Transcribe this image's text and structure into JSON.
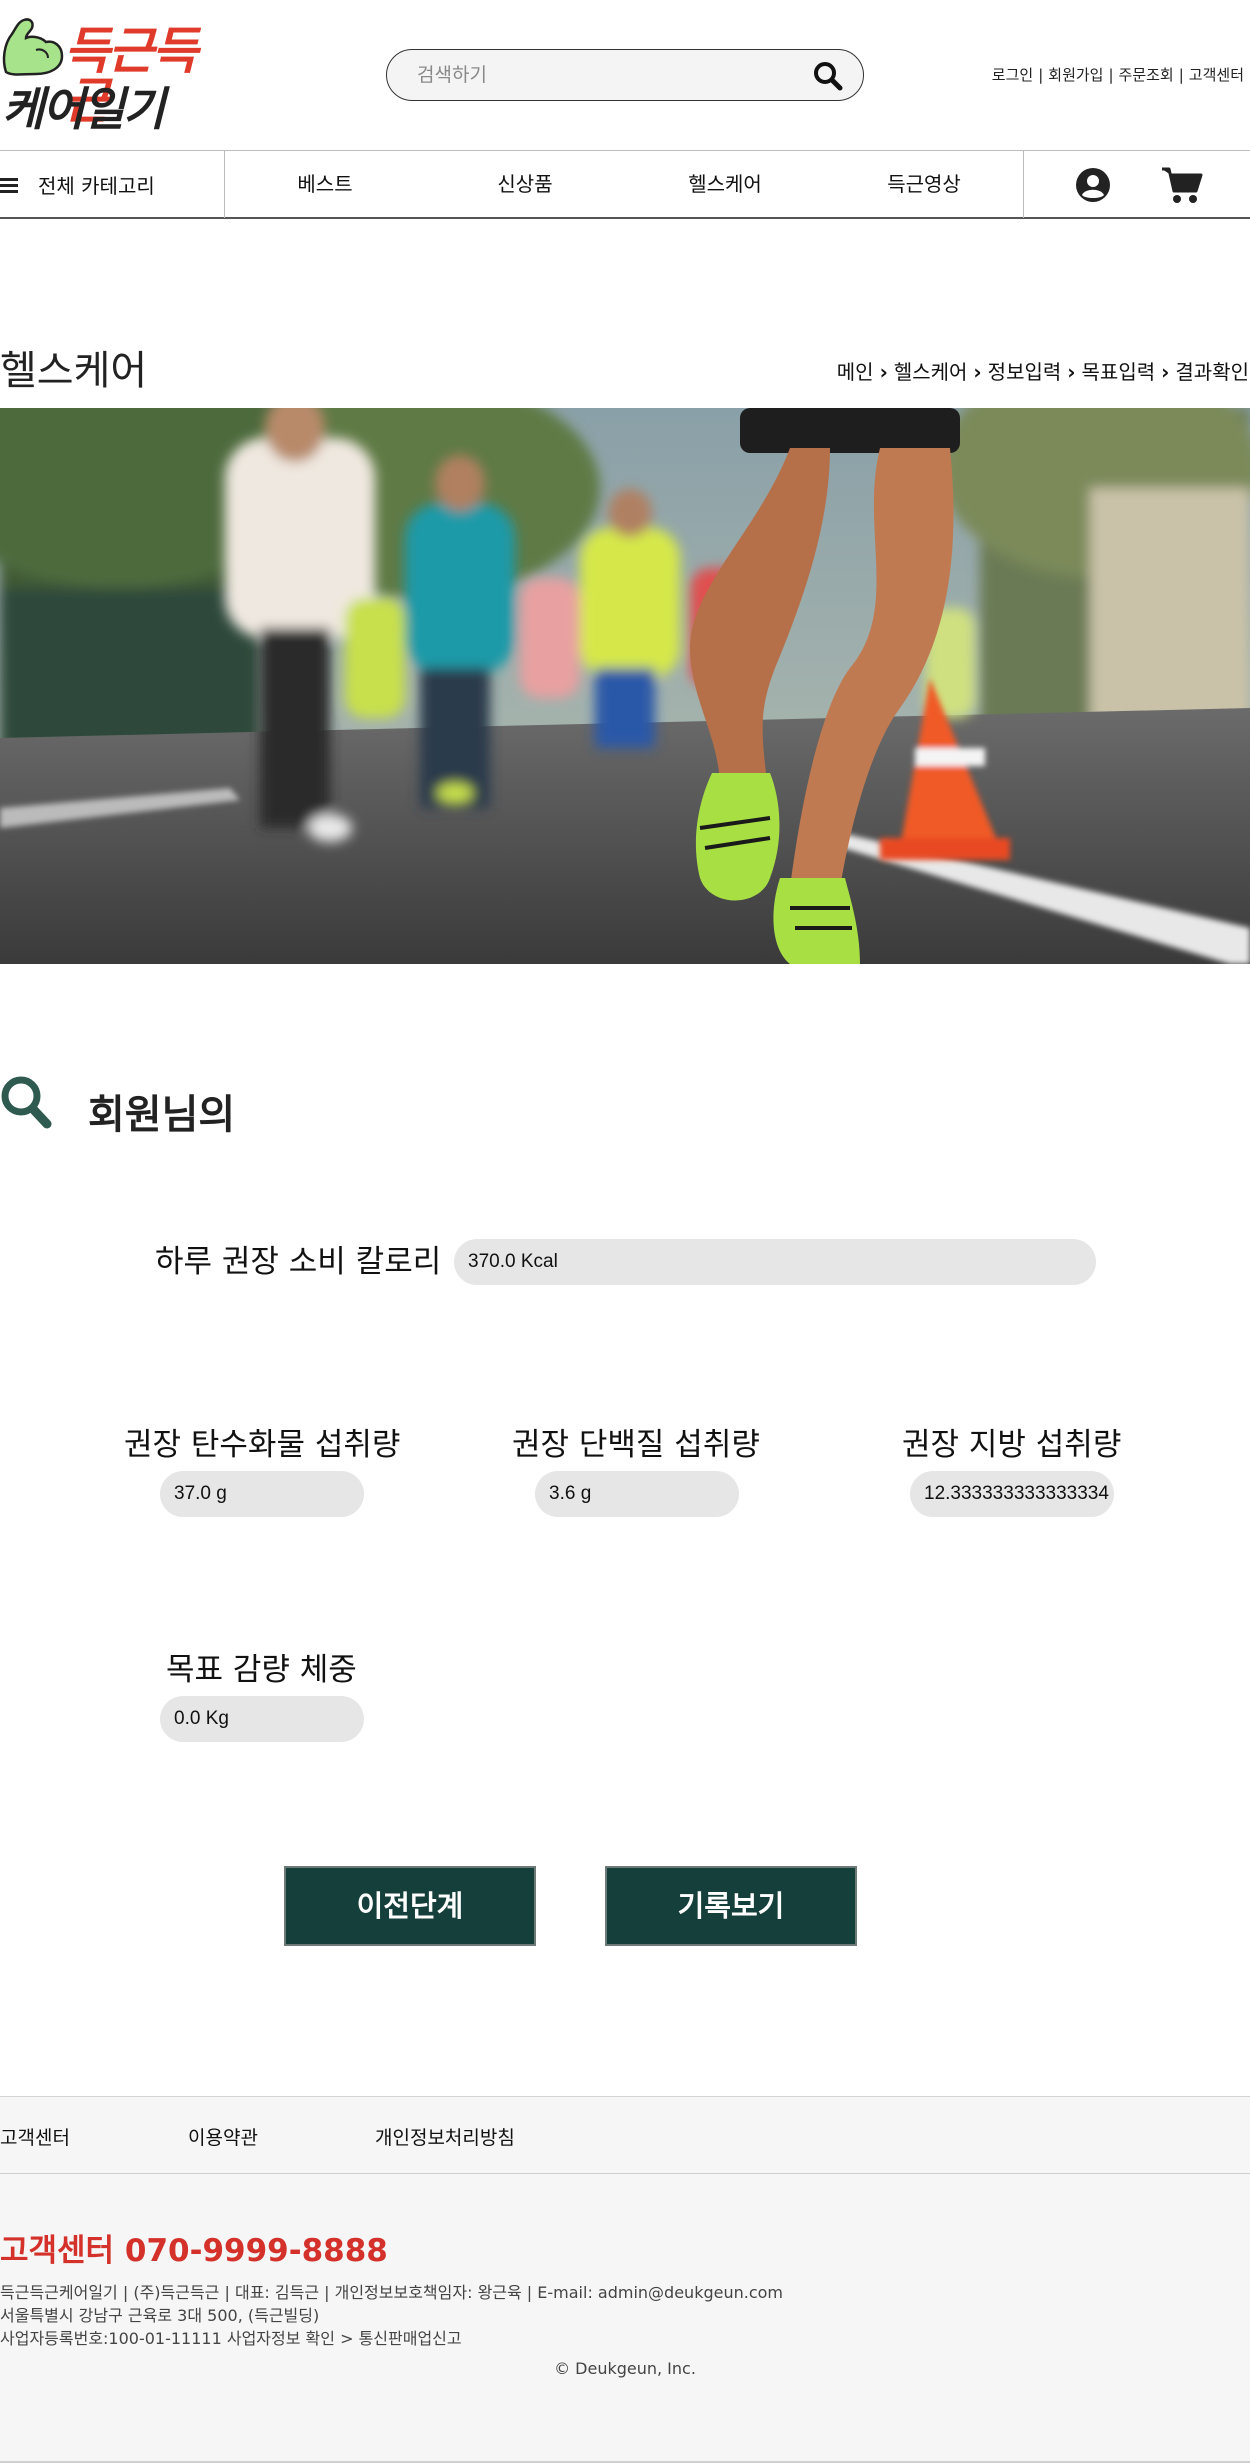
{
  "brand": {
    "logo_line1": "득근득근",
    "logo_line2": "케어일기",
    "logo_green": "#a6e38a",
    "logo_red": "#e03b2a"
  },
  "search": {
    "placeholder": "검색하기",
    "value": ""
  },
  "top_links": [
    "로그인",
    "회원가입",
    "주문조회",
    "고객센터"
  ],
  "nav": {
    "category_label": "전체 카테고리",
    "items": [
      "베스트",
      "신상품",
      "헬스케어",
      "득근영상"
    ],
    "icons": [
      "user-icon",
      "cart-icon"
    ]
  },
  "page": {
    "title": "헬스케어",
    "breadcrumb": [
      "메인",
      "헬스케어",
      "정보입력",
      "목표입력",
      "결과확인"
    ]
  },
  "result": {
    "heading": "회원님의",
    "calorie_label": "하루 권장 소비 칼로리",
    "calorie_value": "370.0 Kcal",
    "carb_label": "권장 탄수화물 섭취량",
    "carb_value": "37.0 g",
    "protein_label": "권장 단백질 섭취량",
    "protein_value": "3.6 g",
    "fat_label": "권장 지방 섭취량",
    "fat_value": "12.333333333333334",
    "weight_label": "목표 감량 체중",
    "weight_value": "0.0 Kg"
  },
  "buttons": {
    "prev": "이전단계",
    "records": "기록보기"
  },
  "footer": {
    "links": [
      "고객센터",
      "이용약관",
      "개인정보처리방침"
    ],
    "cs_phone": "고객센터 070-9999-8888",
    "info_line1": "득근득근케어일기 | (주)득근득근 | 대표: 김득근 | 개인정보보호책임자: 왕근육 | E-mail: admin@deukgeun.com",
    "info_line2": "서울특별시 강남구 근육로 3대 500, (득근빌딩)",
    "info_line3": "사업자등록번호:100-01-11111 사업자정보 확인 > 통신판매업신고",
    "copyright": "© Deukgeun, Inc."
  },
  "colors": {
    "primary_button": "#143f3a",
    "accent_red": "#d3312a",
    "search_icon": "#2f5a50"
  }
}
